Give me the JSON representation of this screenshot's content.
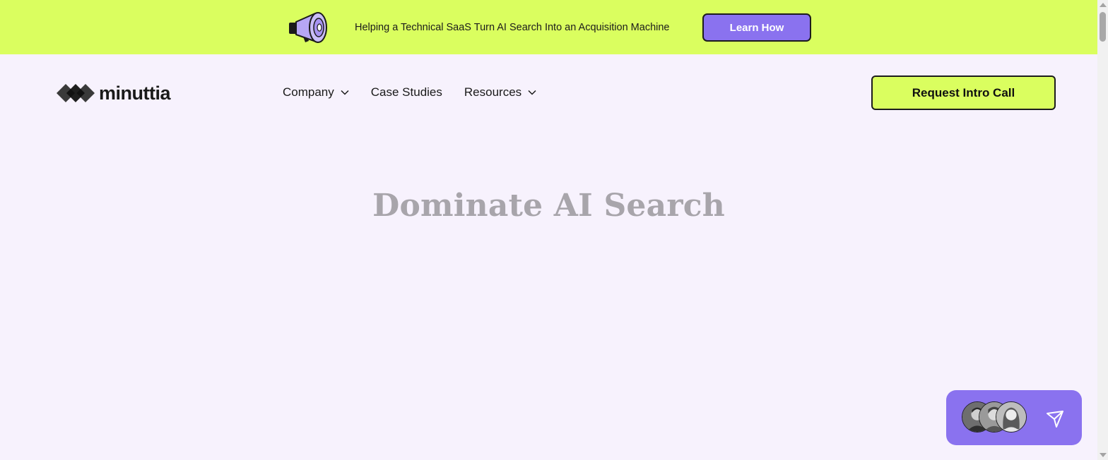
{
  "banner": {
    "text": "Helping a Technical SaaS Turn AI Search Into an Acquisition Machine",
    "button_label": "Learn How",
    "icon": "megaphone-icon",
    "background": "#dafe5f",
    "button_color": "#8a72ef"
  },
  "header": {
    "logo_text": "minuttia",
    "nav": [
      {
        "label": "Company",
        "has_dropdown": true
      },
      {
        "label": "Case Studies",
        "has_dropdown": false
      },
      {
        "label": "Resources",
        "has_dropdown": true
      }
    ],
    "cta_label": "Request Intro Call",
    "cta_color": "#dafe5f"
  },
  "hero": {
    "title": "Dominate AI Search"
  },
  "chat_widget": {
    "avatars": [
      "avatar",
      "avatar",
      "avatar"
    ],
    "icon": "send-icon",
    "background": "#8a72ef"
  },
  "page": {
    "background": "#f7f2fd"
  }
}
